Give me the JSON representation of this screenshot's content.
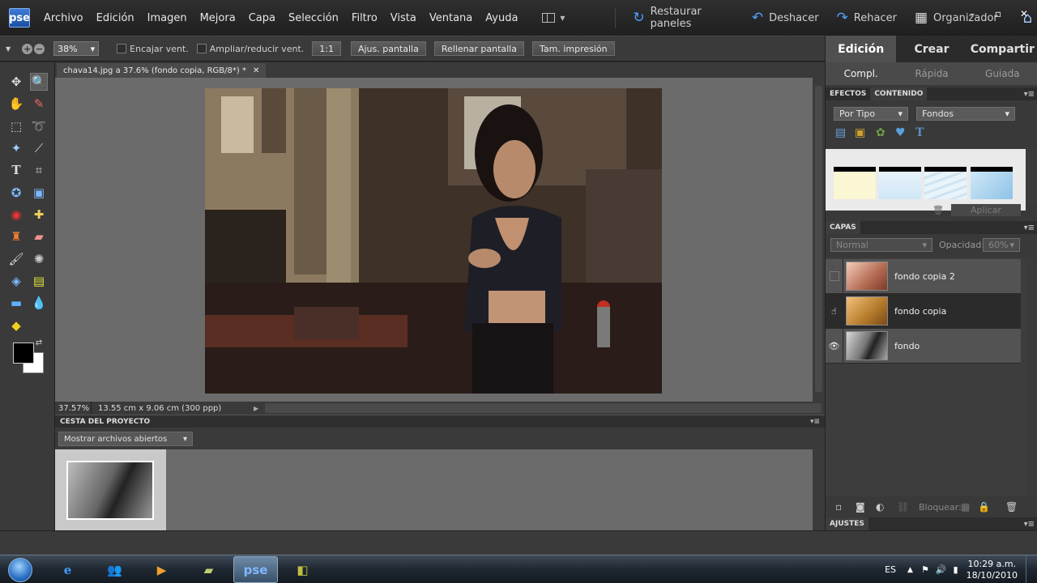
{
  "app": {
    "logo": "pse"
  },
  "menu": [
    "Archivo",
    "Edición",
    "Imagen",
    "Mejora",
    "Capa",
    "Selección",
    "Filtro",
    "Vista",
    "Ventana",
    "Ayuda"
  ],
  "toolbar": {
    "restore": "Restaurar paneles",
    "undo": "Deshacer",
    "redo": "Rehacer",
    "organizer": "Organizador"
  },
  "window_controls": {
    "minimize": "–",
    "maximize": "▫",
    "close": "✕"
  },
  "options": {
    "zoom": "38%",
    "fit_window": "Encajar vent.",
    "resize_windows": "Ampliar/reducir vent.",
    "actual": "1:1",
    "fit_screen": "Ajus. pantalla",
    "fill_screen": "Rellenar pantalla",
    "print_size": "Tam. impresión"
  },
  "document": {
    "tab_title": "chava14.jpg a 37.6% (fondo copia, RGB/8*) *",
    "zoom_status": "37.57%",
    "dimensions": "13.55 cm x 9.06 cm (300 ppp)"
  },
  "project_bin": {
    "header": "CESTA DEL PROYECTO",
    "dropdown": "Mostrar archivos abiertos"
  },
  "panel": {
    "modes": [
      "Edición",
      "Crear",
      "Compartir"
    ],
    "submodes": [
      "Compl.",
      "Rápida",
      "Guiada"
    ],
    "effects_tab": "EFECTOS",
    "content_tab": "CONTENIDO",
    "sort_by": "Por Tipo",
    "category": "Fondos",
    "apply": "Aplicar",
    "layers_header": "CAPAS",
    "blend_mode": "Normal",
    "opacity_label": "Opacidad:",
    "opacity_value": "60%",
    "lock_label": "Bloquear:",
    "adjust_header": "AJUSTES"
  },
  "layers": [
    {
      "name": "fondo copia 2",
      "visible": false,
      "selected": false
    },
    {
      "name": "fondo copia",
      "visible": false,
      "selected": true
    },
    {
      "name": "fondo",
      "visible": true,
      "selected": false
    }
  ],
  "taskbar": {
    "lang": "ES",
    "time": "10:29 a.m.",
    "date": "18/10/2010",
    "pse_label": "pse"
  },
  "colors": {
    "accent": "#4fa1ff",
    "panel_bg": "#393939",
    "canvas_bg": "#6b6b6b"
  }
}
